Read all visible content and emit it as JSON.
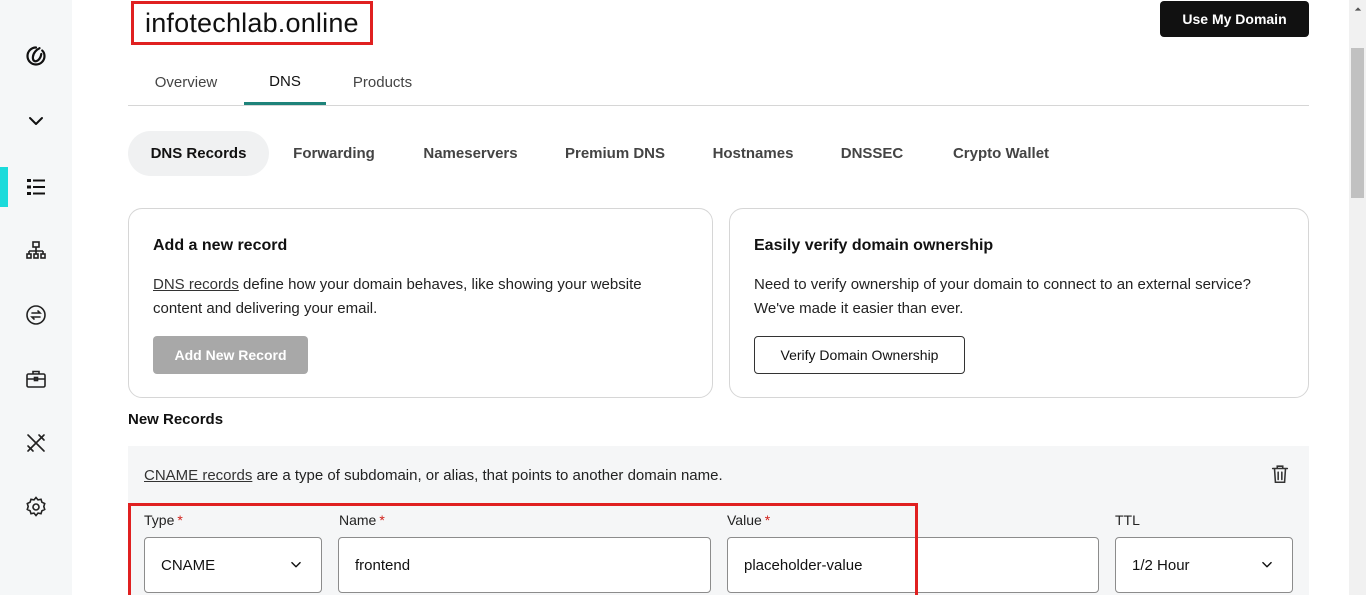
{
  "domain": {
    "name": "infotechlab.online"
  },
  "header": {
    "use_my_domain_label": "Use My Domain"
  },
  "main_tabs": [
    {
      "label": "Overview"
    },
    {
      "label": "DNS"
    },
    {
      "label": "Products"
    }
  ],
  "main_tabs_active": "DNS",
  "sub_tabs": [
    {
      "label": "DNS Records"
    },
    {
      "label": "Forwarding"
    },
    {
      "label": "Nameservers"
    },
    {
      "label": "Premium DNS"
    },
    {
      "label": "Hostnames"
    },
    {
      "label": "DNSSEC"
    },
    {
      "label": "Crypto Wallet"
    }
  ],
  "sub_tabs_active": "DNS Records",
  "add_record_card": {
    "title": "Add a new record",
    "link_text": "DNS records",
    "text_rest_line1": " define how your domain behaves, like showing your website",
    "text_line2": "content and delivering your email.",
    "button_label": "Add New Record"
  },
  "verify_card": {
    "title": "Easily verify domain ownership",
    "text_line1": "Need to verify ownership of your domain to connect to an external service?",
    "text_line2": "We've made it easier than ever.",
    "button_label": "Verify Domain Ownership"
  },
  "new_records": {
    "title": "New Records",
    "desc_link": "CNAME records",
    "desc_rest": " are a type of subdomain, or alias, that points to another domain name.",
    "fields": {
      "type": {
        "label": "Type",
        "required_mark": "*",
        "value": "CNAME"
      },
      "name": {
        "label": "Name",
        "required_mark": "*",
        "value": "frontend"
      },
      "value": {
        "label": "Value",
        "required_mark": "*",
        "value": "placeholder-value"
      },
      "ttl": {
        "label": "TTL",
        "value": "1/2 Hour"
      }
    }
  },
  "sidebar": {
    "items": [
      {
        "icon": "godaddy-logo-icon"
      },
      {
        "icon": "chevron-down-icon"
      },
      {
        "icon": "dns-list-icon",
        "active": true
      },
      {
        "icon": "sitemap-icon"
      },
      {
        "icon": "transfer-icon"
      },
      {
        "icon": "briefcase-icon"
      },
      {
        "icon": "tools-icon"
      },
      {
        "icon": "settings-icon"
      }
    ]
  },
  "colors": {
    "accent_teal": "#1e837a",
    "sidebar_active": "#1bdbdb",
    "annotation_red": "#e02020",
    "primary_button": "#111111",
    "disabled_button": "#a8a8a8"
  }
}
